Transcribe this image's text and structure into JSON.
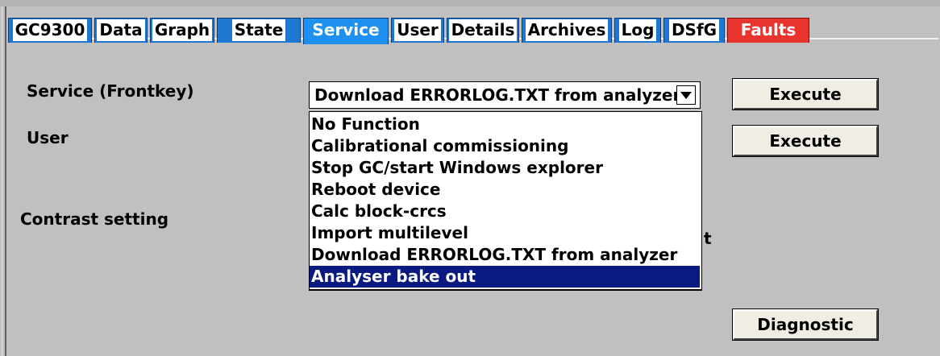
{
  "tabs": [
    {
      "label": "GC9300"
    },
    {
      "label": "Data"
    },
    {
      "label": "Graph"
    },
    {
      "label": "State"
    },
    {
      "label": "Service"
    },
    {
      "label": "User"
    },
    {
      "label": "Details"
    },
    {
      "label": "Archives"
    },
    {
      "label": "Log"
    },
    {
      "label": "DSfG"
    },
    {
      "label": "Faults"
    }
  ],
  "active_tab": "Service",
  "colors": {
    "tab_bg": "#1e78d2",
    "tab_active_bg": "#1e90f0",
    "faults_bg": "#e8342c",
    "selection_bg": "#0a1a80",
    "panel_bg": "#c0c0c0"
  },
  "labels": {
    "service": "Service (Frontkey)",
    "user": "User",
    "contrast": "Contrast setting"
  },
  "service_select": {
    "value": "Download ERRORLOG.TXT from analyzer",
    "options": [
      "No Function",
      "Calibrational commissioning",
      "Stop GC/start Windows explorer",
      "Reboot device",
      "Calc block-crcs",
      "Import multilevel",
      "Download ERRORLOG.TXT from analyzer",
      "Analyser bake out"
    ],
    "highlighted": "Analyser bake out"
  },
  "buttons": {
    "execute_service": "Execute",
    "execute_user": "Execute",
    "diagnostic": "Diagnostic"
  },
  "obscured_char": "t"
}
